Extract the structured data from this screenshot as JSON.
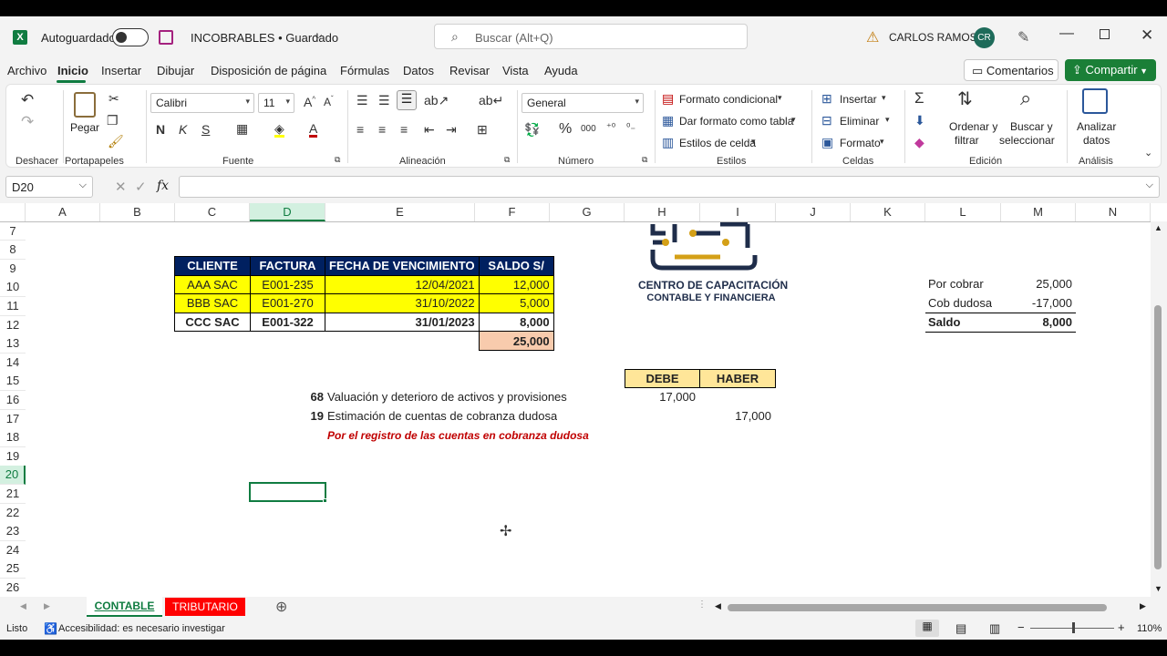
{
  "titlebar": {
    "autosave_label": "Autoguardado",
    "doc_title": "INCOBRABLES • Guardado",
    "search_placeholder": "Buscar (Alt+Q)",
    "user_name": "CARLOS RAMOS",
    "user_initials": "CR",
    "warning_icon": "warning-icon"
  },
  "menu": {
    "tabs": [
      "Archivo",
      "Inicio",
      "Insertar",
      "Dibujar",
      "Disposición de página",
      "Fórmulas",
      "Datos",
      "Revisar",
      "Vista",
      "Ayuda"
    ],
    "active": "Inicio",
    "comments_label": "Comentarios",
    "share_label": "Compartir"
  },
  "ribbon": {
    "undo_label": "Deshacer",
    "paste_label": "Pegar",
    "clipboard_label": "Portapapeles",
    "font_name": "Calibri",
    "font_size": "11",
    "font_label": "Fuente",
    "bold": "N",
    "italic": "K",
    "underline": "S",
    "alignment_label": "Alineación",
    "number_format": "General",
    "number_label": "Número",
    "percent": "%",
    "thousands": "000",
    "cond_format": "Formato condicional",
    "table_format": "Dar formato como tabla",
    "cell_styles": "Estilos de celda",
    "styles_label": "Estilos",
    "insert": "Insertar",
    "delete": "Eliminar",
    "format": "Formato",
    "cells_label": "Celdas",
    "sort_filter_1": "Ordenar y",
    "sort_filter_2": "filtrar",
    "find_select_1": "Buscar y",
    "find_select_2": "seleccionar",
    "editing_label": "Edición",
    "analyze_1": "Analizar",
    "analyze_2": "datos",
    "analysis_label": "Análisis"
  },
  "formula_bar": {
    "name_box": "D20",
    "fx": "fx",
    "formula": ""
  },
  "columns": [
    "A",
    "B",
    "C",
    "D",
    "E",
    "F",
    "G",
    "H",
    "I",
    "J",
    "K",
    "L",
    "M",
    "N"
  ],
  "rows": [
    "7",
    "8",
    "9",
    "10",
    "11",
    "12",
    "13",
    "14",
    "15",
    "16",
    "17",
    "18",
    "19",
    "20",
    "21",
    "22",
    "23",
    "24",
    "25",
    "26"
  ],
  "table": {
    "headers": [
      "CLIENTE",
      "FACTURA",
      "FECHA DE VENCIMIENTO",
      "SALDO S/"
    ],
    "rows": [
      [
        "AAA SAC",
        "E001-235",
        "12/04/2021",
        "12,000"
      ],
      [
        "BBB SAC",
        "E001-270",
        "31/10/2022",
        "5,000"
      ],
      [
        "CCC SAC",
        "E001-322",
        "31/01/2023",
        "8,000"
      ]
    ],
    "total": "25,000"
  },
  "logo": {
    "line1": "CENTRO DE CAPACITACIÓN",
    "line2": "CONTABLE Y FINANCIERA"
  },
  "summary": {
    "rows": [
      {
        "label": "Por cobrar",
        "value": "25,000"
      },
      {
        "label": "Cob dudosa",
        "value": "-17,000"
      },
      {
        "label": "Saldo",
        "value": "8,000"
      }
    ]
  },
  "journal": {
    "debe": "DEBE",
    "haber": "HABER",
    "entries": [
      {
        "account": "68",
        "desc": "Valuación y deterioro de activos y provisiones",
        "debe": "17,000",
        "haber": ""
      },
      {
        "account": "19",
        "desc": "Estimación de cuentas de cobranza dudosa",
        "debe": "",
        "haber": "17,000"
      }
    ],
    "gloss": "Por el registro de las cuentas en cobranza dudosa"
  },
  "sheets": {
    "tabs": [
      "CONTABLE",
      "TRIBUTARIO"
    ],
    "active": "CONTABLE"
  },
  "status": {
    "ready": "Listo",
    "accessibility": "Accesibilidad: es necesario investigar",
    "zoom": "110%"
  },
  "colors": {
    "header_fill": "#002060",
    "yellow_fill": "#ffff00",
    "total_fill": "#f8cbad",
    "journal_header_fill": "#ffe699",
    "gloss_red": "#c00000",
    "excel_green": "#107c41"
  }
}
